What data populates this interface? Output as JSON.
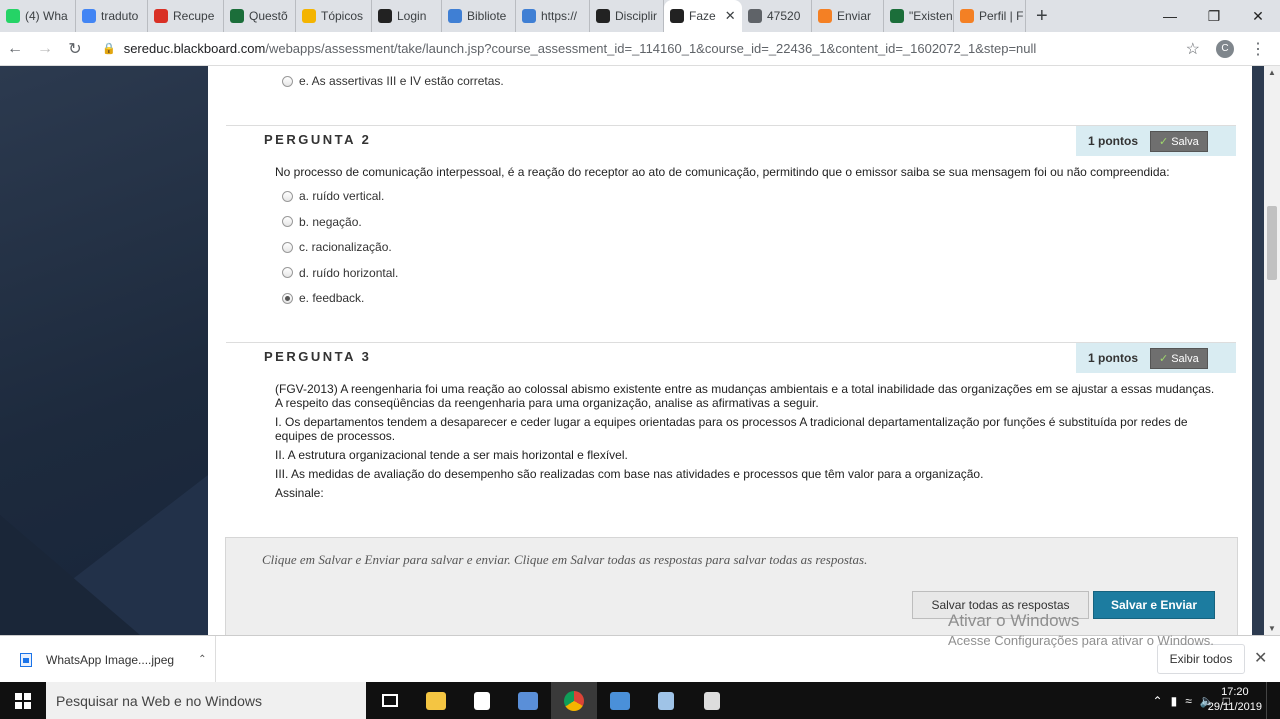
{
  "browser": {
    "tabs": [
      {
        "label": "(4) Wha",
        "icon": "whatsapp-icon",
        "color": "#25d366"
      },
      {
        "label": "traduto",
        "icon": "google-icon",
        "color": "#4285f4"
      },
      {
        "label": "Recupe",
        "icon": "gmail-icon",
        "color": "#d93025"
      },
      {
        "label": "Questõ",
        "icon": "checkmark-icon",
        "color": "#1b6e3a"
      },
      {
        "label": "Tópicos",
        "icon": "drive-icon",
        "color": "#f4b400"
      },
      {
        "label": "Login",
        "icon": "blackboard-icon",
        "color": "#222222"
      },
      {
        "label": "Bibliote",
        "icon": "diamond-icon",
        "color": "#3f7fd4"
      },
      {
        "label": "https://",
        "icon": "diamond-icon",
        "color": "#3f7fd4"
      },
      {
        "label": "Disciplir",
        "icon": "blackboard-icon",
        "color": "#222222"
      },
      {
        "label": "Faze",
        "icon": "blackboard-icon",
        "color": "#222222",
        "active": true
      },
      {
        "label": "47520",
        "icon": "globe-icon",
        "color": "#5f6368"
      },
      {
        "label": "Enviar",
        "icon": "graduation-icon",
        "color": "#f48024"
      },
      {
        "label": "\"Existen",
        "icon": "checkmark-icon",
        "color": "#1b6e3a"
      },
      {
        "label": "Perfil | F",
        "icon": "graduation-icon",
        "color": "#f48024"
      }
    ],
    "url_host": "sereduc.blackboard.com",
    "url_path": "/webapps/assessment/take/launch.jsp?course_assessment_id=_114160_1&course_id=_22436_1&content_id=_1602072_1&step=null",
    "profile_initial": "C"
  },
  "prev_option": {
    "label": "e. As assertivas III e IV estão corretas."
  },
  "question2": {
    "title": "PERGUNTA 2",
    "points": "1 pontos",
    "saved": "Salva",
    "text": "No processo de comunicação interpessoal, é a reação do receptor ao ato de comunicação, permitindo que o emissor saiba se sua mensagem foi ou não compreendida:",
    "options": [
      {
        "label": "a. ruído vertical.",
        "selected": false
      },
      {
        "label": "b. negação.",
        "selected": false
      },
      {
        "label": "c. racionalização.",
        "selected": false
      },
      {
        "label": "d. ruído horizontal.",
        "selected": false
      },
      {
        "label": "e. feedback.",
        "selected": true
      }
    ]
  },
  "question3": {
    "title": "PERGUNTA 3",
    "points": "1 pontos",
    "saved": "Salva",
    "lines": [
      "(FGV-2013) A reengenharia foi uma reação ao colossal abismo existente entre as mudanças ambientais e a total inabilidade das organizações em se ajustar a essas mudanças.",
      "A respeito das conseqüências da reengenharia para uma organização, analise as afirmativas a seguir.",
      "I. Os departamentos tendem a desaparecer e ceder lugar a equipes orientadas para os processos  A tradicional departamentalização por funções é substituída por redes de equipes de processos.",
      "II. A estrutura organizacional tende a ser mais horizontal e flexível.",
      "III. As medidas de avaliação do desempenho são realizadas com base nas atividades e processos que têm valor para a organização.",
      "Assinale:"
    ]
  },
  "footer": {
    "hint": "Clique em Salvar e Enviar para salvar e enviar. Clique em Salvar todas as respostas para salvar todas as respostas.",
    "save_all": "Salvar todas as respostas",
    "save_submit": "Salvar e Enviar"
  },
  "watermark": {
    "line1": "Ativar o Windows",
    "line2": "Acesse Configurações para ativar o Windows."
  },
  "download": {
    "file": "WhatsApp Image....jpeg",
    "show_all": "Exibir todos"
  },
  "taskbar": {
    "search_placeholder": "Pesquisar na Web e no Windows",
    "time": "17:20",
    "date": "29/11/2019"
  }
}
